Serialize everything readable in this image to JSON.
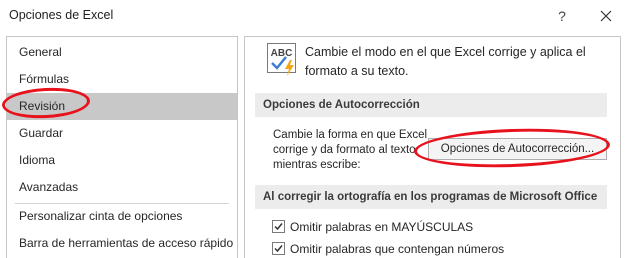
{
  "window": {
    "title": "Opciones de Excel",
    "help_label": "?"
  },
  "sidebar": {
    "items": [
      {
        "label": "General"
      },
      {
        "label": "Fórmulas"
      },
      {
        "label": "Revisión",
        "selected": true
      },
      {
        "label": "Guardar"
      },
      {
        "label": "Idioma"
      },
      {
        "label": "Avanzadas"
      },
      {
        "label": "Personalizar cinta de opciones"
      },
      {
        "label": "Barra de herramientas de acceso rápido"
      }
    ]
  },
  "main": {
    "intro_text": "Cambie el modo en el que Excel corrige y aplica el formato a su texto.",
    "icon": "abc-spelling-icon",
    "autocorrect_section": {
      "header": "Opciones de Autocorrección",
      "description": "Cambie la forma en que Excel corrige y da formato al texto mientras escribe:",
      "button_label": "Opciones de Autocorrección..."
    },
    "spelling_section": {
      "header": "Al corregir la ortografía en los programas de Microsoft Office",
      "options": [
        {
          "label": "Omitir palabras en MAYÚSCULAS",
          "checked": true
        },
        {
          "label": "Omitir palabras que contengan números",
          "checked": true
        }
      ]
    }
  },
  "annotations": {
    "color": "#e8121c"
  }
}
